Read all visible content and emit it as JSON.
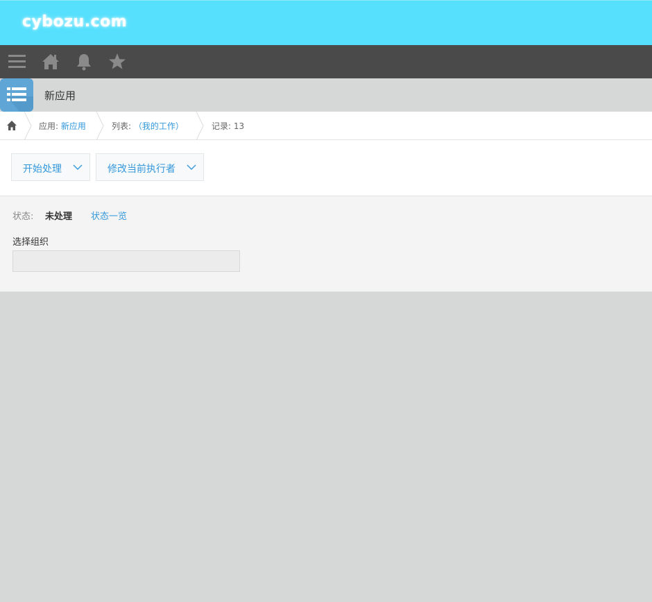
{
  "header": {
    "logo_text": "cybozu.com",
    "accent_color": "#56e0fd"
  },
  "nav": {
    "icons": [
      "menu-icon",
      "home-icon",
      "bell-icon",
      "star-icon"
    ]
  },
  "app": {
    "title": "新应用",
    "icon": "list-app-icon"
  },
  "breadcrumb": {
    "app_prefix": "应用:",
    "app_name": "新应用",
    "view_prefix": "列表:",
    "view_name": "（我的工作）",
    "record_label": "记录: 13"
  },
  "toolbar": {
    "start_label": "开始处理",
    "change_assignee_label": "修改当前执行者"
  },
  "status": {
    "label": "状态:",
    "value": "未处理",
    "list_link": "状态一览"
  },
  "org_field": {
    "label": "选择组织",
    "value": ""
  }
}
